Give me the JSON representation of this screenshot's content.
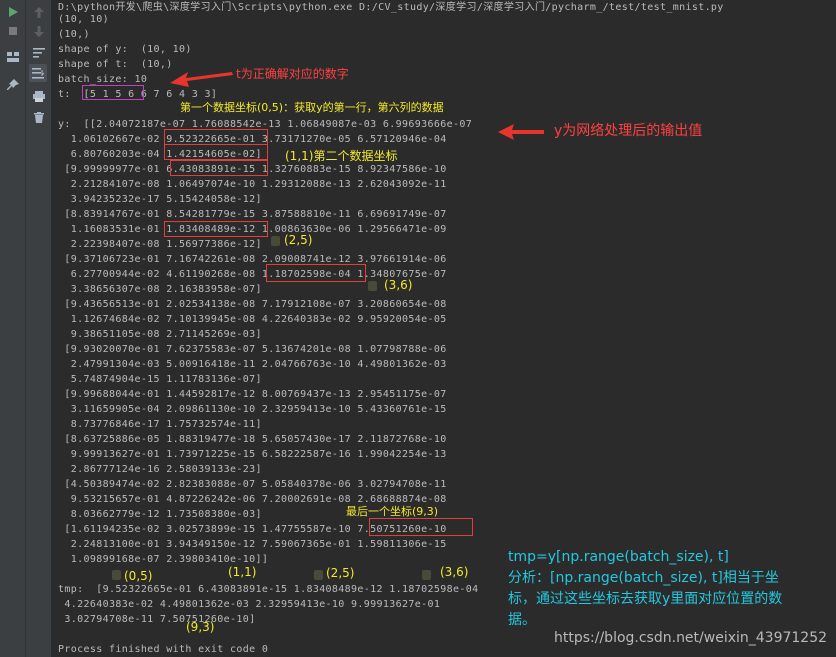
{
  "toolbar": {
    "left_icons": [
      "run-icon",
      "arrow-up-icon",
      "stop-icon",
      "arrow-down-icon",
      "layout-icon",
      "soft-wrap-icon",
      "pin-icon",
      "scroll-to-end-icon",
      "print-icon",
      "trash-icon"
    ]
  },
  "console": {
    "lines": [
      "D:\\python开发\\爬虫\\深度学习入门\\Scripts\\python.exe D:/CV_study/深度学习/深度学习入门/pycharm_/test/test_mnist.py",
      "(10, 10)",
      "(10,)",
      "shape of y:  (10, 10)",
      "shape of t:  (10,)",
      "batch_size: 10",
      "t:  [5 1 5 6 6 7 6 4 3 3]",
      "",
      "y:  [[2.04072187e-07 1.76088542e-13 1.06849087e-03 6.99693666e-07",
      "  1.06102667e-02 9.52322665e-01 3.73171270e-05 6.57120946e-04",
      "  6.80760203e-04 1.42154605e-02]",
      " [9.99999977e-01 6.43083891e-15 1.32760883e-15 8.92347586e-10",
      "  2.21284107e-08 1.06497074e-10 1.29312088e-13 2.62043092e-11",
      "  3.94235232e-17 5.15424058e-12]",
      " [8.83914767e-01 8.54281779e-15 3.87588810e-11 6.69691749e-07",
      "  1.16083531e-01 1.83408489e-12 1.00863630e-06 1.29566471e-09",
      "  2.22398407e-08 1.56977386e-12]",
      " [9.37106723e-01 7.16742261e-08 2.09008741e-12 3.97661914e-06",
      "  6.27700944e-02 4.61190268e-08 1.18702598e-04 1.34807675e-07",
      "  3.38656307e-08 2.16383958e-07]",
      " [9.43656513e-01 2.02534138e-08 7.17912108e-07 3.20860654e-08",
      "  1.12674684e-02 7.10139945e-08 4.22640383e-02 9.95920054e-05",
      "  9.38651105e-08 2.71145269e-03]",
      " [9.93020070e-01 7.62375583e-07 5.13674201e-08 1.07798788e-06",
      "  2.47991304e-03 5.00916418e-11 2.04766763e-10 4.49801362e-03",
      "  5.74874904e-15 1.11783136e-07]",
      " [9.99688044e-01 1.44592817e-12 8.00769437e-13 2.95451175e-07",
      "  3.11659905e-04 2.09861130e-10 2.32959413e-10 5.43360761e-15",
      "  8.73776846e-17 1.75732574e-11]",
      " [8.63725886e-05 1.88319477e-18 5.65057430e-17 2.11872768e-10",
      "  9.99913627e-01 1.73971225e-15 6.58222587e-16 1.99042254e-13",
      "  2.86777124e-16 2.58039133e-23]",
      " [4.50389474e-02 2.82383088e-07 5.05840378e-06 3.02794708e-11",
      "  9.53215657e-01 4.87226242e-06 7.20002691e-08 2.68688874e-08",
      "  8.03662779e-12 1.73508380e-03]",
      " [1.61194235e-02 3.02573899e-15 1.47755587e-10 7.50751260e-10",
      "  2.24813100e-01 3.94349150e-12 7.59067365e-01 1.59811306e-15",
      "  1.09899168e-07 2.39803410e-10]]",
      "",
      "tmp:  [9.52322665e-01 6.43083891e-15 1.83408489e-12 1.18702598e-04",
      " 4.22640383e-02 4.49801362e-03 2.32959413e-10 9.99913627e-01",
      " 3.02794708e-11 7.50751260e-10]",
      "",
      "Process finished with exit code 0"
    ]
  },
  "annotations": {
    "t_note": "t为正确解对应的数字",
    "first_coord": "第一个数据坐标(0,5)：获取y的第一行，第六列的数据",
    "y_note": "y为网络处理后的输出值",
    "second_coord": "(1,1)第二个数据坐标",
    "coord_2_5": "(2,5)",
    "coord_3_6": "(3,6)",
    "last_coord": "最后一个坐标(9,3)",
    "tmp_label_0_5": "(0,5)",
    "tmp_label_1_1": "(1,1)",
    "tmp_label_2_5": "(2,5)",
    "tmp_label_3_6": "(3,6)",
    "tmp_label_9_3": "(9,3)",
    "explain_line1": "tmp=y[np.range(batch_size), t]",
    "explain_line2": "分析：[np.range(batch_size), t]相当于坐",
    "explain_line3": "标，通过这些坐标去获取y里面对应位置的数",
    "explain_line4": "据。"
  },
  "watermark": "https://blog.csdn.net/weixin_43971252",
  "colors": {
    "annotation_red": "#ff4040",
    "annotation_yellow": "#f4ea2a",
    "annotation_cyan": "#22c8e0",
    "box_red": "#e0403a",
    "box_magenta": "#c040c0"
  }
}
